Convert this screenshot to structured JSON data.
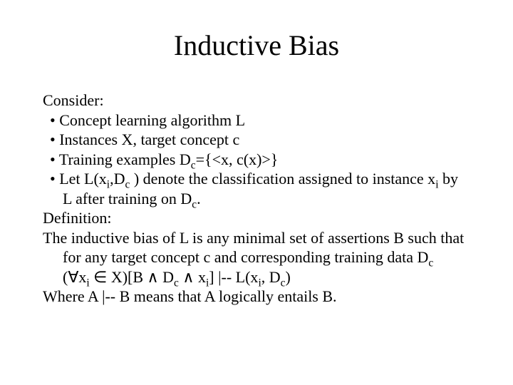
{
  "title": "Inductive Bias",
  "lines": {
    "consider": "Consider:",
    "b1": "Concept learning algorithm L",
    "b2": "Instances X, target concept c",
    "b3_pre": "Training examples D",
    "b3_sub": "c",
    "b3_post": "={<x, c(x)>}",
    "b4_pre": "Let L(x",
    "b4_s1": "i",
    "b4_mid1": ",D",
    "b4_s2": "c",
    "b4_mid2": " ) denote the classification assigned to instance x",
    "b4_s3": "i",
    "b4_mid3": " by L after training on D",
    "b4_s4": "c",
    "b4_end": ".",
    "definition": "Definition:",
    "d1_pre": "The inductive bias of L is any minimal set of assertions B such that for any target concept c and corresponding training data D",
    "d1_sub": "c",
    "f_pre": "(∀x",
    "f_s1": "i",
    "f_mid1": " ∈ X)[B ∧ D",
    "f_s2": "c",
    "f_mid2": " ∧ x",
    "f_s3": "i",
    "f_mid3": "] |-- L(x",
    "f_s4": "i",
    "f_mid4": ", D",
    "f_s5": "c",
    "f_end": ")",
    "where": "Where A |-- B means that A logically entails B."
  }
}
